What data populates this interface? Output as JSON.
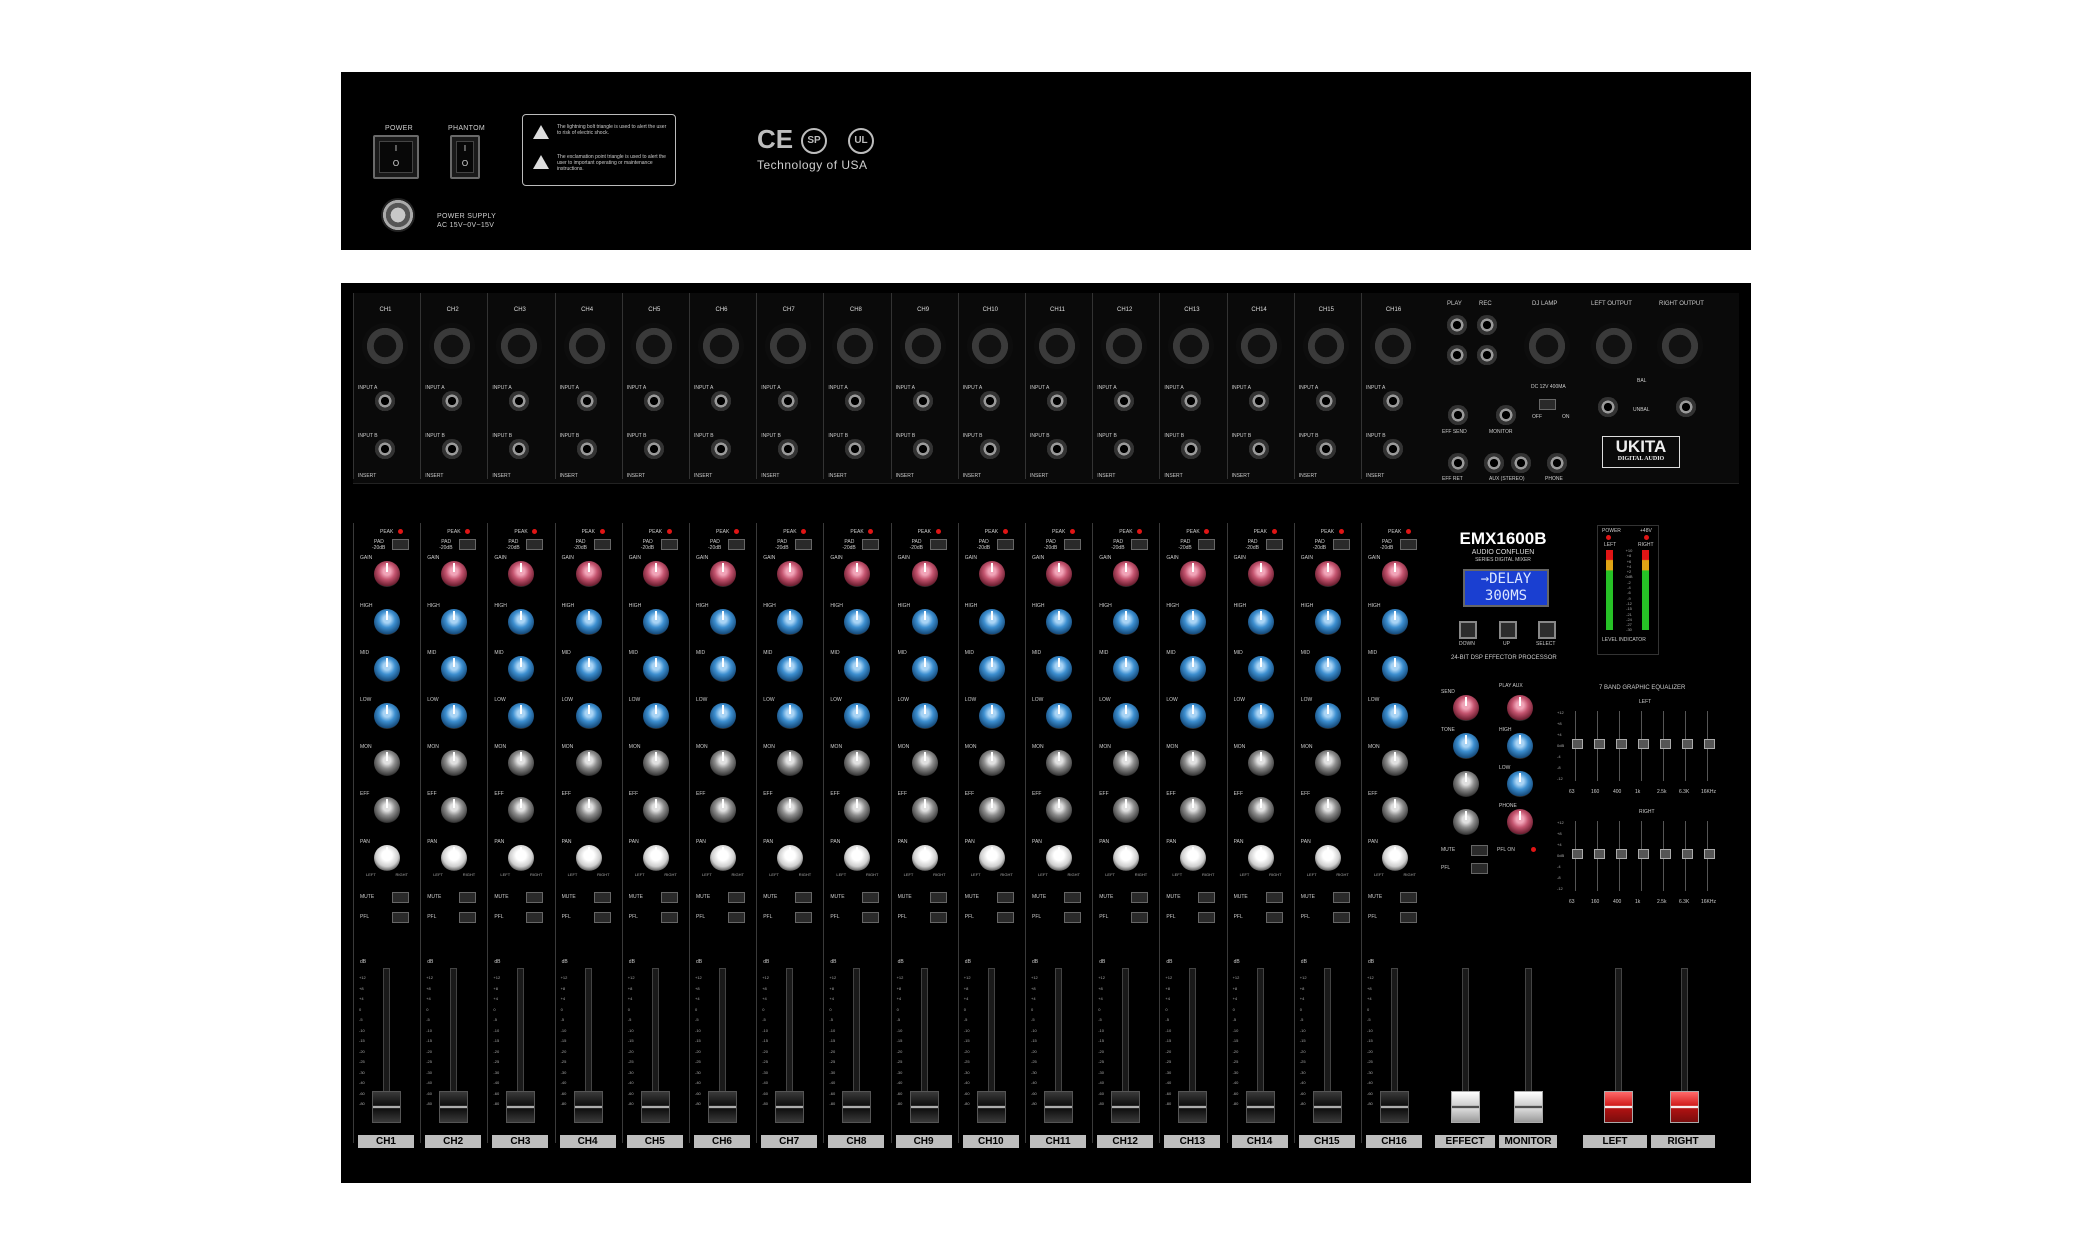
{
  "rear_panel": {
    "power_label": "POWER",
    "phantom_label": "PHANTOM",
    "power_on_symbol": "I",
    "power_off_symbol": "O",
    "power_supply_label": "POWER SUPPLY",
    "power_supply_spec": "AC 15V~0V~15V",
    "warning_lightning": "The lightning bolt triangle is used to alert the user to risk of electric shock.",
    "warning_exclamation": "The exclamation point triangle is used to alert the user to important operating or maintenance instructions.",
    "cert_ce": "CE",
    "cert_csa": "SP",
    "cert_ul": "UL",
    "technology": "Technology of USA"
  },
  "channels": [
    "CH1",
    "CH2",
    "CH3",
    "CH4",
    "CH5",
    "CH6",
    "CH7",
    "CH8",
    "CH9",
    "CH10",
    "CH11",
    "CH12",
    "CH13",
    "CH14",
    "CH15",
    "CH16"
  ],
  "io_labels": {
    "input_a": "INPUT A",
    "input_b": "INPUT B",
    "insert": "INSERT",
    "play": "PLAY",
    "rec": "REC",
    "dj_lamp": "DJ LAMP",
    "dj_lamp_spec": "DC 12V 400MA",
    "left_output": "LEFT OUTPUT",
    "right_output": "RIGHT OUTPUT",
    "bal": "BAL",
    "unbal": "UNBAL",
    "eff_send": "EFF SEND",
    "monitor": "MONITOR",
    "eff_ret": "EFF RET",
    "aux_stereo": "AUX (STEREO)",
    "phone": "PHONE",
    "off": "OFF",
    "on": "ON",
    "l": "L",
    "r": "R"
  },
  "brand": {
    "logo": "UKITA",
    "logo_sub": "DIGITAL AUDIO"
  },
  "strip_labels": {
    "peak": "PEAK",
    "pad": "PAD",
    "pad_value": "-20dB",
    "gain": "GAIN",
    "high": "HIGH",
    "mid": "MID",
    "low": "LOW",
    "mon": "MON",
    "eff": "EFF",
    "pan": "PAN",
    "mute": "MUTE",
    "pfl": "PFL",
    "left": "LEFT",
    "right": "RIGHT",
    "db": "dB"
  },
  "fader_scale": [
    "+12",
    "+8",
    "+4",
    "0",
    "-5",
    "-10",
    "-15",
    "-20",
    "-25",
    "-30",
    "-40",
    "-60",
    "-80"
  ],
  "master": {
    "model": "EMX1600B",
    "subtitle": "AUDIO CONFLUEN",
    "subtitle2": "SERIES DIGITAL MIXER",
    "lcd_line1": "→DELAY",
    "lcd_line2": "300MS",
    "btn_down": "DOWN",
    "btn_up": "UP",
    "btn_select": "SELECT",
    "dsp_label": "24-BIT DSP EFFECTOR PROCESSOR",
    "power_led": "POWER",
    "phantom_led": "+48V",
    "meter_left": "LEFT",
    "meter_right": "RIGHT",
    "level_indicator": "LEVEL INDICATOR",
    "meter_scale": [
      "+10",
      "+8",
      "+6",
      "+4",
      "+2",
      "0dB",
      "-2",
      "-4",
      "-6",
      "-9",
      "-12",
      "-15",
      "-21",
      "-24",
      "-27",
      "-30"
    ],
    "eq_title": "7 BAND GRAPHIC EQUALIZER",
    "eq_left": "LEFT",
    "eq_right": "RIGHT",
    "eq_freqs": [
      "63",
      "160",
      "400",
      "1k",
      "2.5k",
      "6.3K",
      "16KHz"
    ],
    "eq_scale": [
      "+12",
      "+8",
      "+4",
      "0dB",
      "-4",
      "-8",
      "-12"
    ],
    "send": "SEND",
    "tone": "TONE",
    "play_aux": "PLAY AUX",
    "high": "HIGH",
    "low": "LOW",
    "phone": "PHONE",
    "pfl_on": "PFL ON",
    "effect": "EFFECT",
    "monitor": "MONITOR",
    "left": "LEFT",
    "right": "RIGHT"
  }
}
